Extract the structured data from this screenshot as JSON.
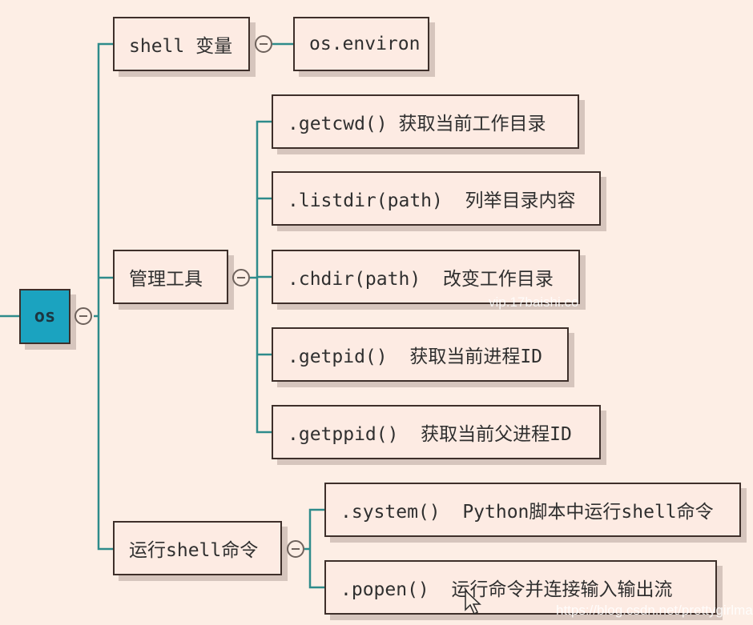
{
  "diagram": {
    "type": "mind-map",
    "colors": {
      "background": "#fdeee5",
      "node_fill": "#fdebe3",
      "root_fill": "#1ba3c0",
      "connector": "#2e8b8b",
      "border": "#3e2f2a"
    },
    "root": {
      "label": "os",
      "collapse_icon": "minus-circle-icon",
      "children": [
        {
          "label": "shell 变量",
          "children": [
            {
              "label": "os.environ"
            }
          ]
        },
        {
          "label": "管理工具",
          "children": [
            {
              "label": ".getcwd() 获取当前工作目录"
            },
            {
              "label": ".listdir(path)  列举目录内容"
            },
            {
              "label": ".chdir(path)  改变工作目录"
            },
            {
              "label": ".getpid()  获取当前进程ID"
            },
            {
              "label": ".getppid()  获取当前父进程ID"
            }
          ]
        },
        {
          "label": "运行shell命令",
          "children": [
            {
              "label": ".system()  Python脚本中运行shell命令"
            },
            {
              "label": ".popen()  运行命令并连接输入输出流"
            }
          ]
        }
      ]
    }
  },
  "watermarks": {
    "mid": "vip.17baishi.co",
    "bottom": "https://blog.csdn.net/prettygirlman"
  }
}
